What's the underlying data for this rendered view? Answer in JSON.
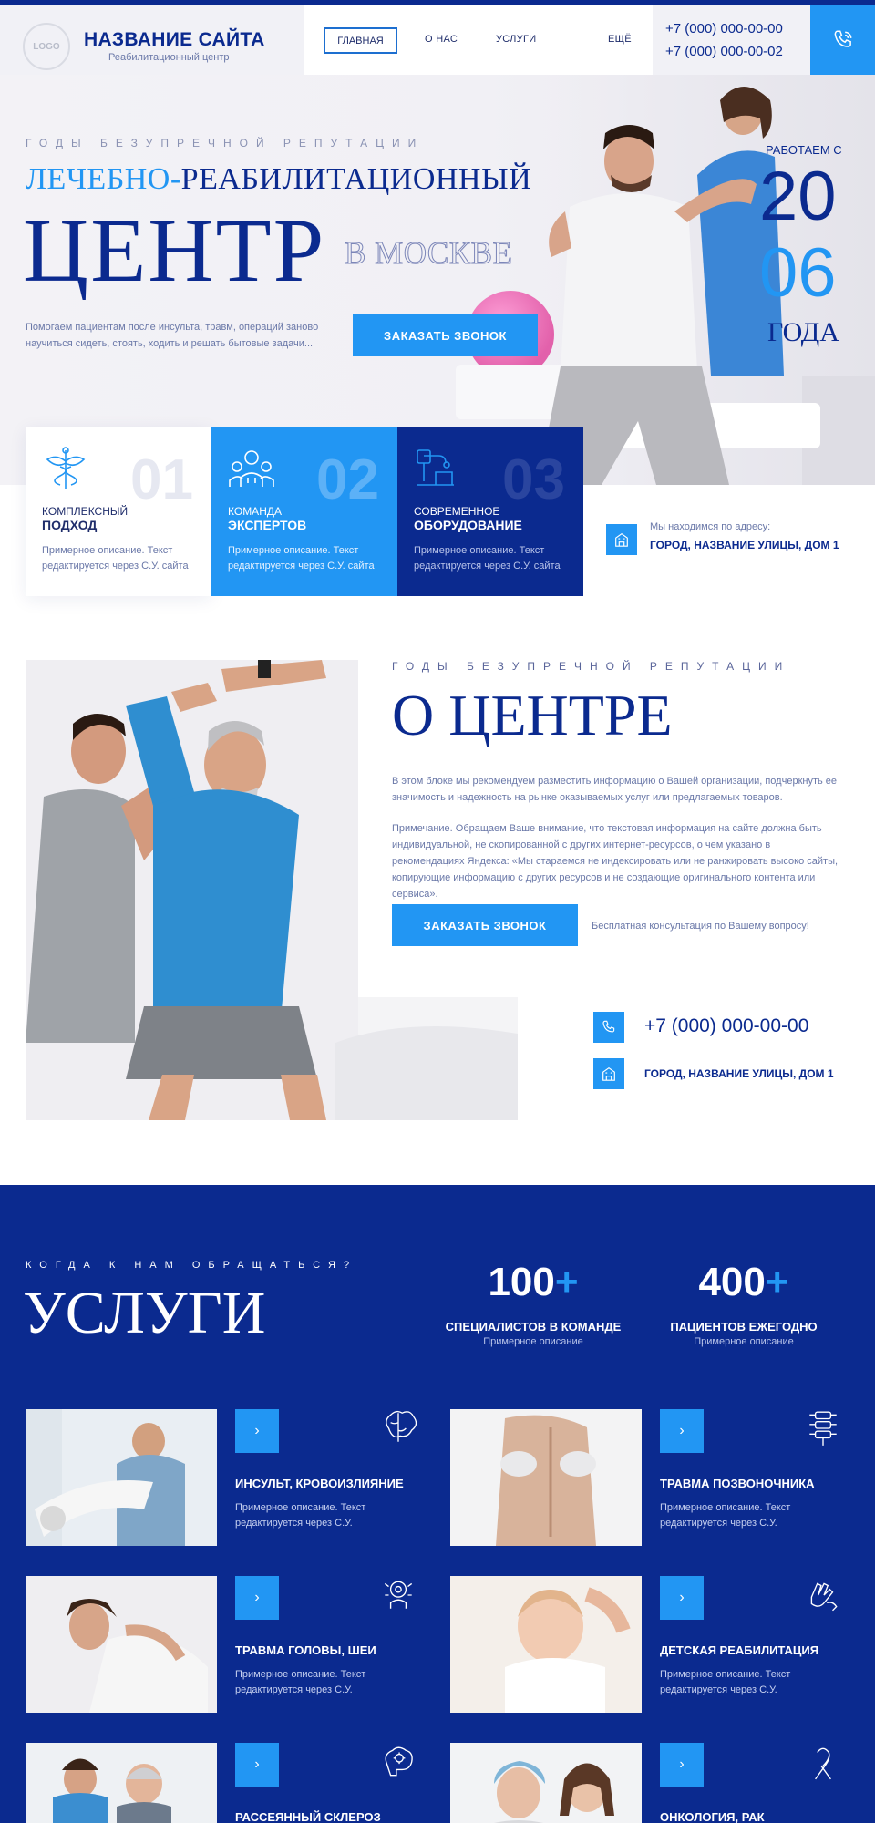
{
  "header": {
    "logo_text": "LOGO",
    "site_title": "НАЗВАНИЕ САЙТА",
    "site_subtitle": "Реабилитационный центр",
    "nav": [
      "ГЛАВНАЯ",
      "О НАС",
      "УСЛУГИ",
      "ЕЩЁ"
    ],
    "phones": [
      "+7 (000) 000-00-00",
      "+7 (000) 000-00-02"
    ],
    "call_icon": "phone-icon"
  },
  "hero": {
    "kicker": "ГОДЫ БЕЗУПРЕЧНОЙ РЕПУТАЦИИ",
    "title_accent": "ЛЕЧЕБНО-",
    "title_rest": "РЕАБИЛИТАЦИОННЫЙ",
    "big": "ЦЕНТР",
    "city": "В МОСКВЕ",
    "description": "Помогаем пациентам после инсульта, травм, операций заново научиться сидеть, стоять, ходить и решать бытовые задачи...",
    "button": "ЗАКАЗАТЬ ЗВОНОК",
    "work_since": "РАБОТАЕМ С",
    "year_a": "20",
    "year_b": "06",
    "years_word": "ГОДА"
  },
  "features": [
    {
      "num": "01",
      "line1": "КОМПЛЕКСНЫЙ",
      "line2": "ПОДХОД",
      "desc": "Примерное описание. Текст редактируется через С.У. сайта",
      "icon": "caduceus-icon"
    },
    {
      "num": "02",
      "line1": "КОМАНДА",
      "line2": "ЭКСПЕРТОВ",
      "desc": "Примерное описание. Текст редактируется через С.У. сайта",
      "icon": "doctors-team-icon"
    },
    {
      "num": "03",
      "line1": "СОВРЕМЕННОЕ",
      "line2": "ОБОРУДОВАНИЕ",
      "desc": "Примерное описание. Текст редактируется через С.У. сайта",
      "icon": "medical-equipment-icon"
    }
  ],
  "address": {
    "label": "Мы находимся по адресу:",
    "value": "ГОРОД, НАЗВАНИЕ УЛИЦЫ, ДОМ 1",
    "icon": "building-icon"
  },
  "about": {
    "kicker": "ГОДЫ БЕЗУПРЕЧНОЙ РЕПУТАЦИИ",
    "title": "О ЦЕНТРЕ",
    "p1": "В этом блоке мы рекомендуем разместить информацию о Вашей организации, подчеркнуть ее значимость и надежность на рынке оказываемых услуг или предлагаемых товаров.",
    "p2": "Примечание. Обращаем Ваше внимание, что текстовая информация на сайте должна быть индивидуальной, не скопированной с других интернет-ресурсов, о чем указано в рекомендациях Яндекса: «Мы стараемся не индексировать или не ранжировать высоко сайты, копирующие информацию с других ресурсов и не создающие оригинального контента или сервиса».",
    "button": "ЗАКАЗАТЬ ЗВОНОК",
    "note": "Бесплатная консультация по Вашему вопросу!",
    "phone": "+7 (000) 000-00-00",
    "address": "ГОРОД, НАЗВАНИЕ УЛИЦЫ, ДОМ 1"
  },
  "services": {
    "kicker": "КОГДА К НАМ ОБРАЩАТЬСЯ?",
    "title": "УСЛУГИ",
    "stats": [
      {
        "num": "100",
        "plus": "+",
        "label": "СПЕЦИАЛИСТОВ В КОМАНДЕ",
        "sub": "Примерное описание"
      },
      {
        "num": "400",
        "plus": "+",
        "label": "ПАЦИЕНТОВ ЕЖЕГОДНО",
        "sub": "Примерное описание"
      }
    ],
    "items": [
      {
        "name": "ИНСУЛЬТ, КРОВОИЗЛИЯНИЕ",
        "desc": "Примерное описание. Текст редактируется через С.У.",
        "icon": "brain-icon"
      },
      {
        "name": "ТРАВМА ПОЗВОНОЧНИКА",
        "desc": "Примерное описание. Текст редактируется через С.У.",
        "icon": "spine-icon"
      },
      {
        "name": "ТРАВМА ГОЛОВЫ, ШЕИ",
        "desc": "Примерное описание. Текст редактируется через С.У.",
        "icon": "head-neck-icon"
      },
      {
        "name": "ДЕТСКАЯ РЕАБИЛИТАЦИЯ",
        "desc": "Примерное описание. Текст редактируется через С.У.",
        "icon": "child-hand-icon"
      },
      {
        "name": "РАССЕЯННЫЙ СКЛЕРОЗ",
        "desc": "",
        "icon": "brain-gear-icon"
      },
      {
        "name": "ОНКОЛОГИЯ, РАК",
        "desc": "",
        "icon": "ribbon-icon"
      }
    ],
    "arrow": "›"
  },
  "colors": {
    "navy": "#0b2a8f",
    "accent": "#2296f3",
    "light_bg": "#f1f0f5"
  }
}
